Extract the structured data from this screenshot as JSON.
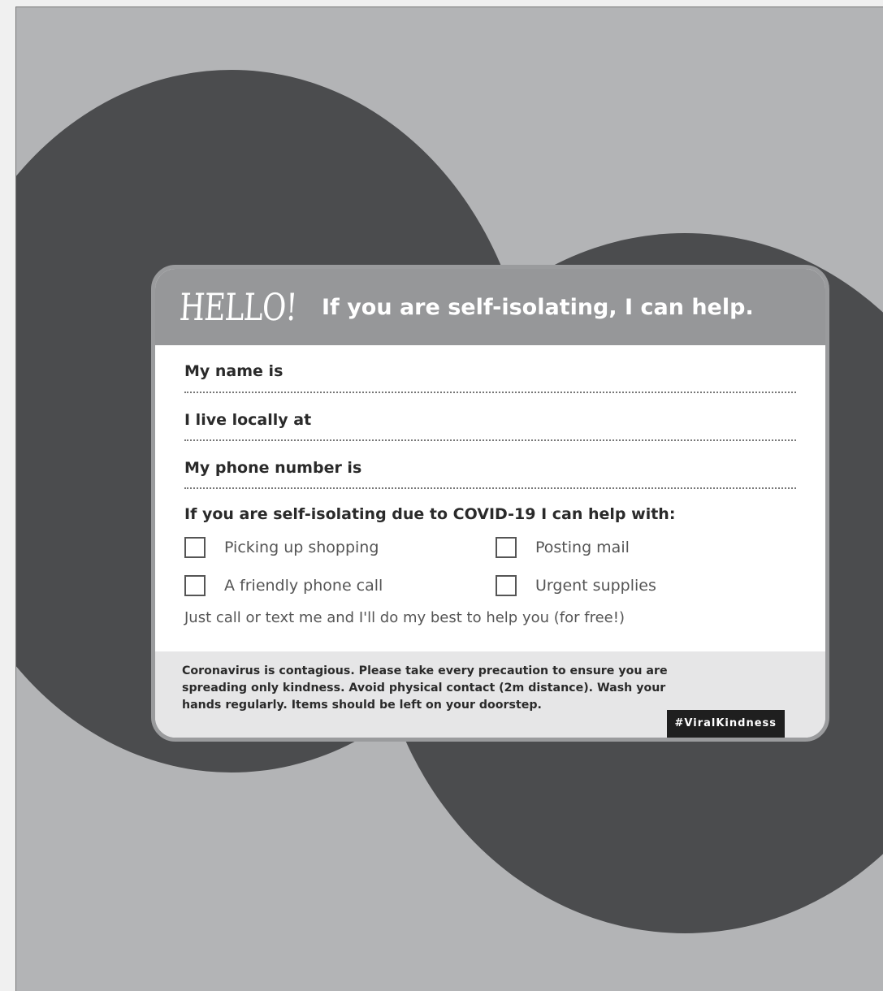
{
  "card": {
    "hello": "HELLO!",
    "headline": "If you are self-isolating, I can help.",
    "fields": [
      {
        "label": "My name is"
      },
      {
        "label": "I live locally at"
      },
      {
        "label": "My phone number is"
      }
    ],
    "help_title": "If you are self-isolating due to COVID-19 I can help with:",
    "options": [
      {
        "label": "Picking up shopping",
        "checked": false
      },
      {
        "label": "Posting mail",
        "checked": false
      },
      {
        "label": "A friendly phone call",
        "checked": false
      },
      {
        "label": "Urgent supplies",
        "checked": false
      }
    ],
    "note": "Just call or text me and I'll do my best to help you (for free!)",
    "footer_lines": [
      "Coronavirus is contagious. Please take every precaution to ensure you are",
      "spreading only kindness. Avoid physical contact (2m distance). Wash your",
      "hands regularly. Items should be left on your doorstep."
    ],
    "hashtag": "#ViralKindness"
  },
  "colors": {
    "background": "#b3b4b6",
    "circles": "#4b4c4e",
    "header": "#969799",
    "footer": "#e6e6e7",
    "tag": "#1f1f1f"
  }
}
